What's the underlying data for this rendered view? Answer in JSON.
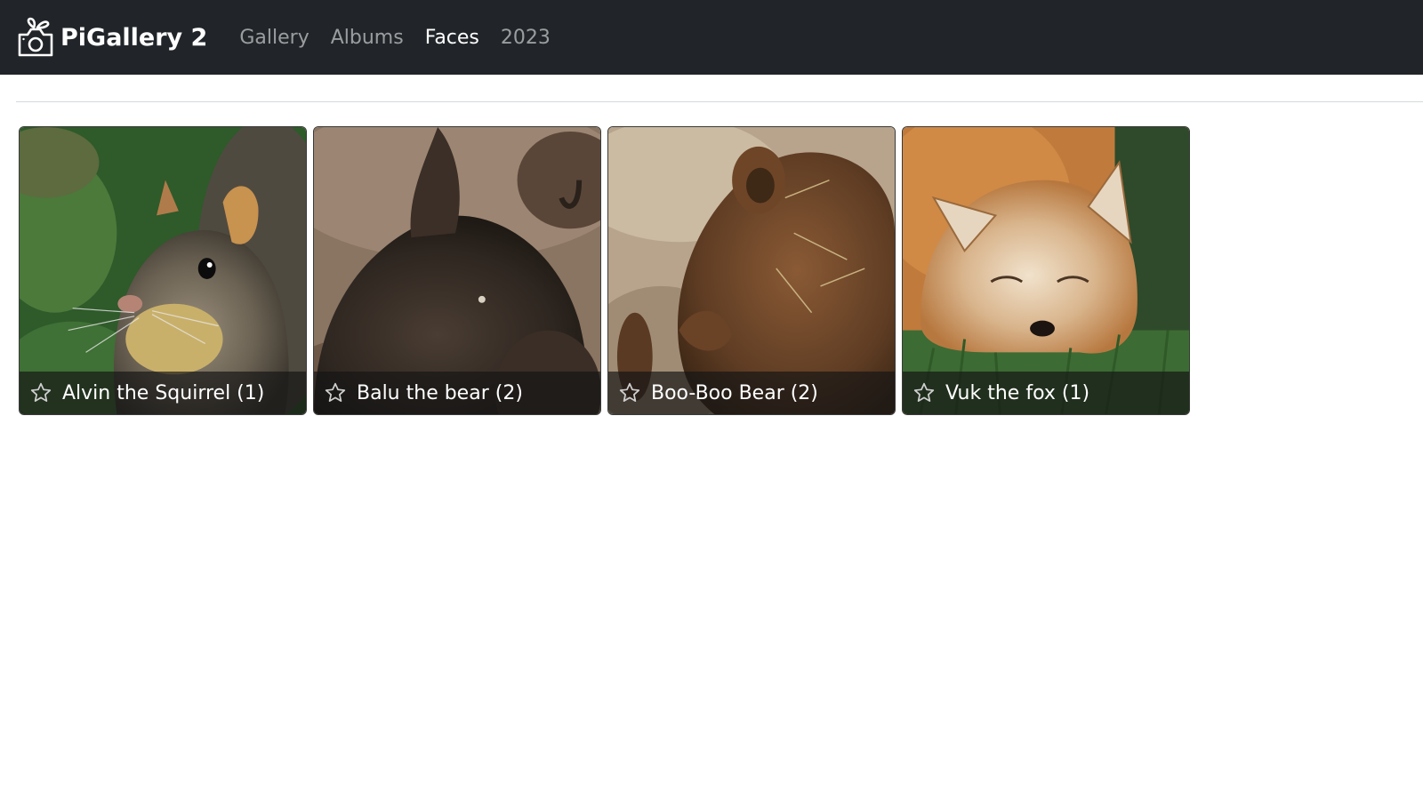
{
  "navbar": {
    "brand": {
      "icon": "camera-icon",
      "title": "PiGallery 2"
    },
    "links": [
      {
        "label": "Gallery",
        "active": false
      },
      {
        "label": "Albums",
        "active": false
      },
      {
        "label": "Faces",
        "active": true
      },
      {
        "label": "2023",
        "active": false
      }
    ]
  },
  "faces": [
    {
      "name": "Alvin the Squirrel",
      "count": "(1)",
      "label": "Alvin the Squirrel (1)",
      "favorite_icon": "star-outline-icon",
      "photo_subject": "squirrel"
    },
    {
      "name": "Balu the bear",
      "count": "(2)",
      "label": "Balu the bear (2)",
      "favorite_icon": "star-outline-icon",
      "photo_subject": "bear"
    },
    {
      "name": "Boo-Boo Bear",
      "count": "(2)",
      "label": "Boo-Boo Bear (2)",
      "favorite_icon": "star-outline-icon",
      "photo_subject": "bear"
    },
    {
      "name": "Vuk the fox",
      "count": "(1)",
      "label": "Vuk the fox (1)",
      "favorite_icon": "star-outline-icon",
      "photo_subject": "fox"
    }
  ],
  "colors": {
    "navbar_bg": "#212529",
    "nav_link": "#8c8f93",
    "nav_link_active": "#ffffff",
    "caption_bg": "#141414"
  }
}
